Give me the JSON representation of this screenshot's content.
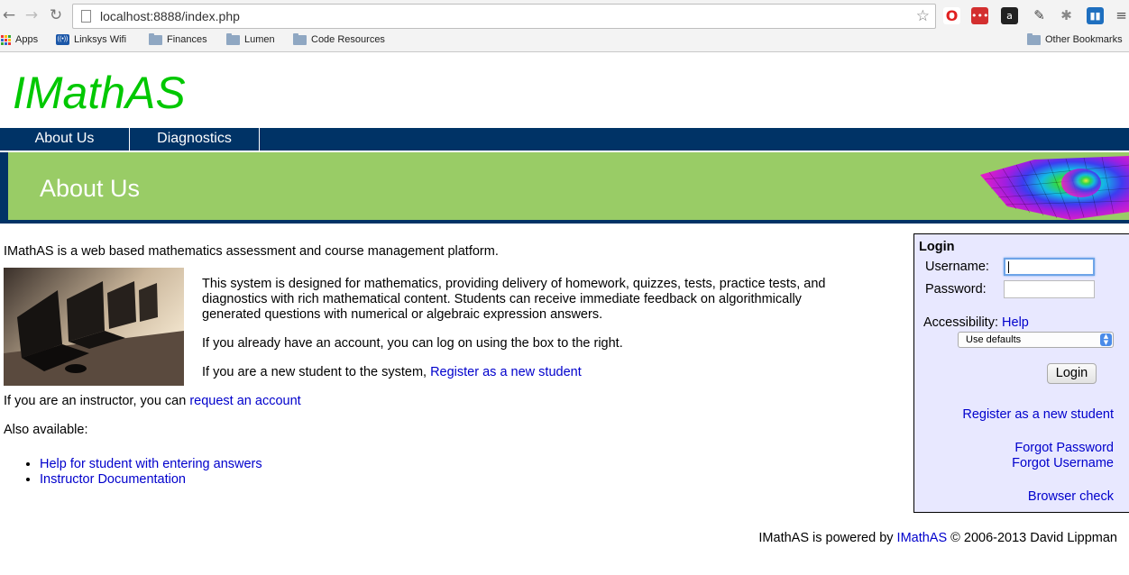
{
  "browser": {
    "url": "localhost:8888/index.php",
    "bookmarks": [
      {
        "label": "Apps",
        "icon": "apps-grid-icon"
      },
      {
        "label": "Linksys Wifi",
        "icon": "wifi-icon"
      },
      {
        "label": "Finances",
        "icon": "folder-icon"
      },
      {
        "label": "Lumen",
        "icon": "folder-icon"
      },
      {
        "label": "Code Resources",
        "icon": "folder-icon"
      }
    ],
    "other_bookmarks": "Other Bookmarks",
    "extensions": [
      "opera-icon",
      "lastpass-icon",
      "amazon-icon",
      "eyedropper-icon",
      "bug-icon",
      "trello-icon",
      "menu-icon"
    ]
  },
  "site": {
    "logo": "IMathAS",
    "nav": [
      "About Us",
      "Diagnostics"
    ],
    "banner_title": "About Us"
  },
  "content": {
    "intro": "IMathAS is a web based mathematics assessment and course management platform.",
    "desc1": "This system is designed for mathematics, providing delivery of homework, quizzes, tests, practice tests, and",
    "desc2": "diagnostics with rich mathematical content. Students can receive immediate feedback on algorithmically",
    "desc3": "generated questions with numerical or algebraic expression answers.",
    "existing": "If you already have an account, you can log on using the box to the right.",
    "new_student_text": "If you are a new student to the system, ",
    "new_student_link": "Register as a new student",
    "instructor_text": "If you are an instructor, you can ",
    "instructor_link": "request an account",
    "also": "Also available:",
    "links": [
      "Help for student with entering answers",
      "Instructor Documentation"
    ]
  },
  "login": {
    "title": "Login",
    "username_label": "Username:",
    "password_label": "Password:",
    "username_value": "",
    "password_value": "",
    "accessibility_label": "Accessibility: ",
    "help_link": "Help",
    "accessibility_selected": "Use defaults",
    "button": "Login",
    "register_link": "Register as a new student",
    "forgot_password": "Forgot Password",
    "forgot_username": "Forgot Username",
    "browser_check": "Browser check"
  },
  "footer": {
    "prefix": "IMathAS is powered by ",
    "link": "IMathAS",
    "suffix": " © 2006-2013 David Lippman"
  },
  "colors": {
    "logo": "#00c800",
    "nav_bg": "#003366",
    "banner_bg": "#99cc66",
    "link": "#0000cc",
    "login_bg": "#e8e8ff"
  }
}
